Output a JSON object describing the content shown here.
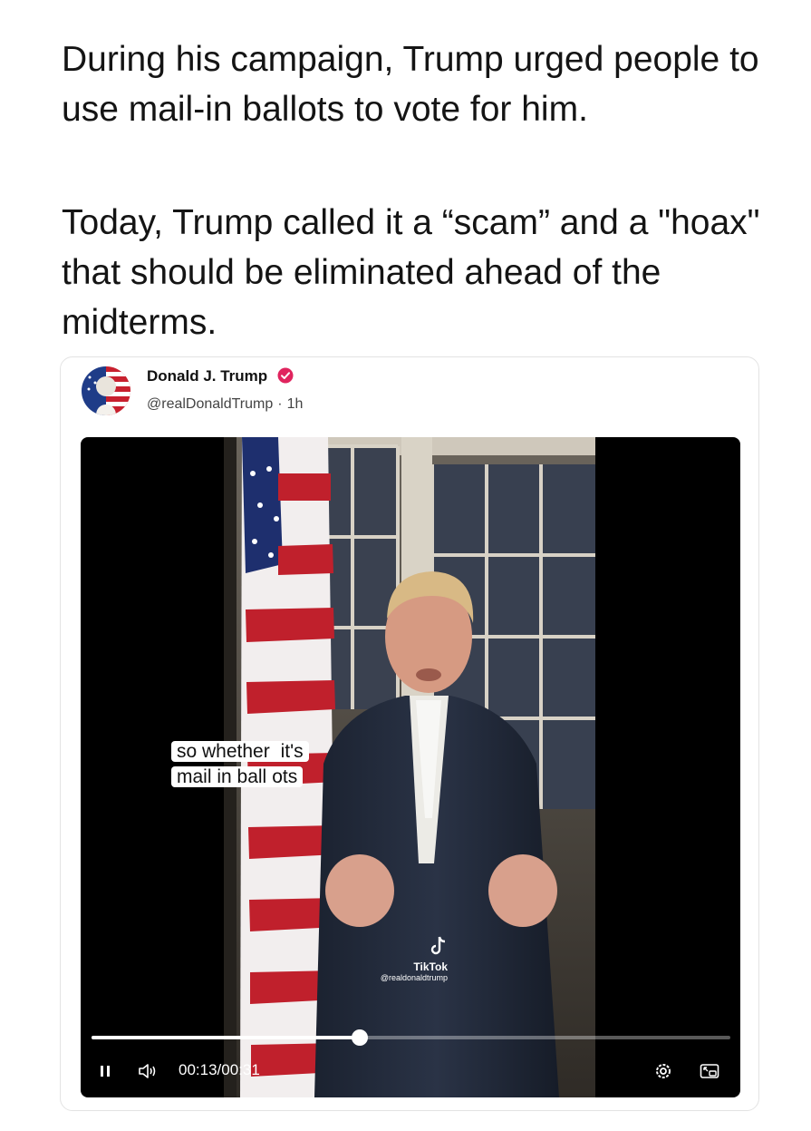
{
  "post": {
    "paragraphs": [
      "During his campaign, Trump urged people to use mail-in ballots to vote for him.",
      "Today, Trump called it a “scam” and a \"hoax\" that should be eliminated ahead of the midterms."
    ]
  },
  "embed": {
    "author_name": "Donald J. Trump",
    "handle": "@realDonaldTrump",
    "separator": "·",
    "time_ago": "1h",
    "verified_color": "#e0245e",
    "avatar_icon": "flag-portrait-avatar"
  },
  "video": {
    "subtitle_line1_pre": "so whether ",
    "subtitle_line1_word": "it's",
    "subtitle_line2_pre": "mail in ball",
    "subtitle_line2_word": "ots",
    "watermark_brand": "TikTok",
    "watermark_user": "@realdonaldtrump",
    "current_time": "00:13",
    "time_separator": "/",
    "duration": "00:31",
    "progress_fraction": 0.42,
    "play_state": "playing",
    "icons": {
      "pause": "pause-icon",
      "volume": "volume-icon",
      "settings": "settings-icon",
      "pip": "picture-in-picture-icon"
    }
  }
}
